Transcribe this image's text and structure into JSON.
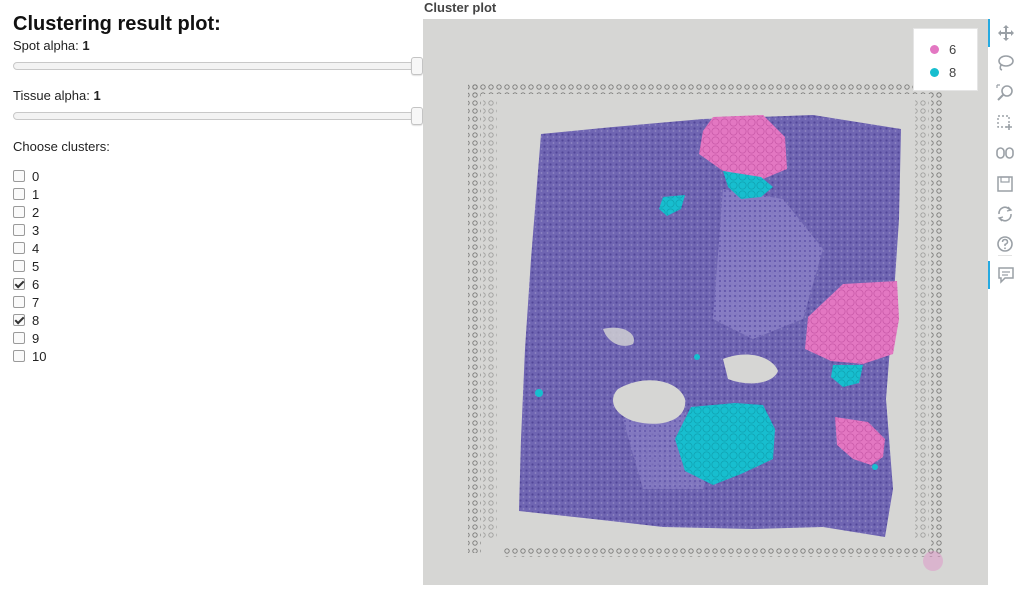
{
  "page_title": "Clustering result plot:",
  "spot_alpha": {
    "label": "Spot alpha:",
    "value": "1",
    "fraction": 1.0
  },
  "tissue_alpha": {
    "label": "Tissue alpha:",
    "value": "1",
    "fraction": 1.0
  },
  "choose_label": "Choose clusters:",
  "clusters": [
    {
      "label": "0",
      "checked": false
    },
    {
      "label": "1",
      "checked": false
    },
    {
      "label": "2",
      "checked": false
    },
    {
      "label": "3",
      "checked": false
    },
    {
      "label": "4",
      "checked": false
    },
    {
      "label": "5",
      "checked": false
    },
    {
      "label": "6",
      "checked": true
    },
    {
      "label": "7",
      "checked": false
    },
    {
      "label": "8",
      "checked": true
    },
    {
      "label": "9",
      "checked": false
    },
    {
      "label": "10",
      "checked": false
    }
  ],
  "plot": {
    "title": "Cluster plot",
    "legend": [
      {
        "label": "6",
        "color": "#e377c2"
      },
      {
        "label": "8",
        "color": "#17becf"
      }
    ]
  },
  "toolbar": {
    "tools": [
      {
        "name": "pan-icon",
        "active": true
      },
      {
        "name": "lasso-select-icon",
        "active": false
      },
      {
        "name": "wheel-zoom-icon",
        "active": false
      },
      {
        "name": "box-select-icon",
        "active": false
      },
      {
        "name": "link-icon",
        "active": false
      },
      {
        "name": "save-icon",
        "active": false
      },
      {
        "name": "reset-icon",
        "active": false
      },
      {
        "name": "help-icon",
        "active": false
      },
      {
        "name": "hover-icon",
        "active": true
      }
    ]
  },
  "colors": {
    "cluster_6": "#e377c2",
    "cluster_8": "#17becf",
    "tissue": "#6a5fb0",
    "background": "#d8d8d6"
  }
}
